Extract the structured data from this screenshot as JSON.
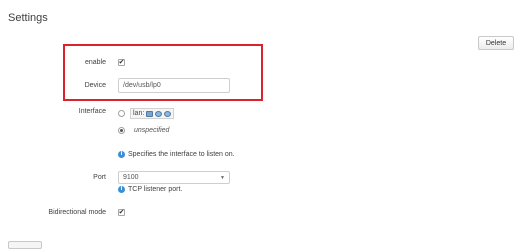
{
  "page": {
    "title": "Settings"
  },
  "actions": {
    "delete_label": "Delete"
  },
  "form": {
    "enable_label": "enable",
    "enable_checked": true,
    "device_label": "Device",
    "device_value": "/dev/usb/lp0",
    "interface_label": "Interface",
    "interface_option_lan": "lan:",
    "interface_option_unspecified": "unspecified",
    "interface_selected": "unspecified",
    "interface_hint": "Specifies the interface to listen on.",
    "port_label": "Port",
    "port_value": "9100",
    "port_hint": "TCP listener port.",
    "bidirectional_label": "Bidirectional mode",
    "bidirectional_checked": true
  },
  "annotation": {
    "highlight_color": "#d9232d"
  },
  "icons": {
    "checkbox_check": "✔",
    "info": "i",
    "dropdown": "▼",
    "lan_icons": [
      "network-icon",
      "globe-icon",
      "globe-icon"
    ]
  }
}
